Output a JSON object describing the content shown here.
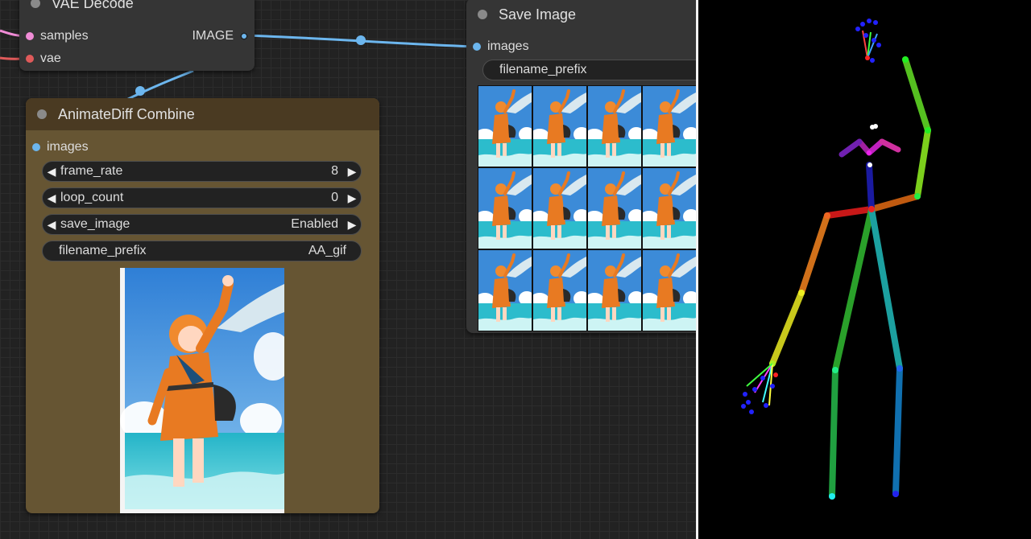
{
  "vae_decode": {
    "title": "VAE Decode",
    "inputs": [
      {
        "label": "samples",
        "color": "#f08cd6"
      },
      {
        "label": "vae",
        "color": "#e05a5a"
      }
    ],
    "output": {
      "label": "IMAGE",
      "color": "#6cb6ee"
    }
  },
  "save_image": {
    "title": "Save Image",
    "input": {
      "label": "images",
      "color": "#6cb6ee"
    },
    "widget_label": "filename_prefix",
    "grid": {
      "rows": 3,
      "cols": 4
    }
  },
  "animatediff": {
    "title": "AnimateDiff Combine",
    "input": {
      "label": "images",
      "color": "#6cb6ee"
    },
    "widgets": [
      {
        "label": "frame_rate",
        "value": "8",
        "arrows": true
      },
      {
        "label": "loop_count",
        "value": "0",
        "arrows": true
      },
      {
        "label": "save_image",
        "value": "Enabled",
        "arrows": true
      },
      {
        "label": "filename_prefix",
        "value": "AA_gif",
        "arrows": false
      }
    ]
  },
  "colors": {
    "wire": "#6cb6ee",
    "node_bg": "#353535",
    "combine_bg": "#665533",
    "combine_title": "#4a3a22"
  }
}
